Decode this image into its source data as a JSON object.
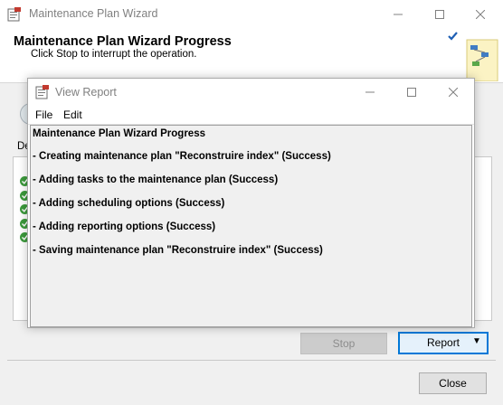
{
  "wizard": {
    "title": "Maintenance Plan Wizard",
    "header_title": "Maintenance Plan Wizard Progress",
    "header_subtitle": "Click Stop to interrupt the operation.",
    "details_label": "De",
    "stop_label": "Stop",
    "report_label": "Report",
    "close_label": "Close",
    "check_count": 5
  },
  "report": {
    "title": "View Report",
    "menu": [
      "File",
      "Edit"
    ],
    "heading": "Maintenance Plan Wizard Progress",
    "lines": [
      "- Creating maintenance plan \"Reconstruire index\" (Success)",
      "- Adding tasks to the maintenance plan (Success)",
      "- Adding scheduling options (Success)",
      "- Adding reporting options (Success)",
      "- Saving maintenance plan \"Reconstruire index\" (Success)"
    ]
  },
  "colors": {
    "accent": "#0078d7",
    "success": "#3c9a3c",
    "checkmark_blue": "#1e5fb4"
  }
}
